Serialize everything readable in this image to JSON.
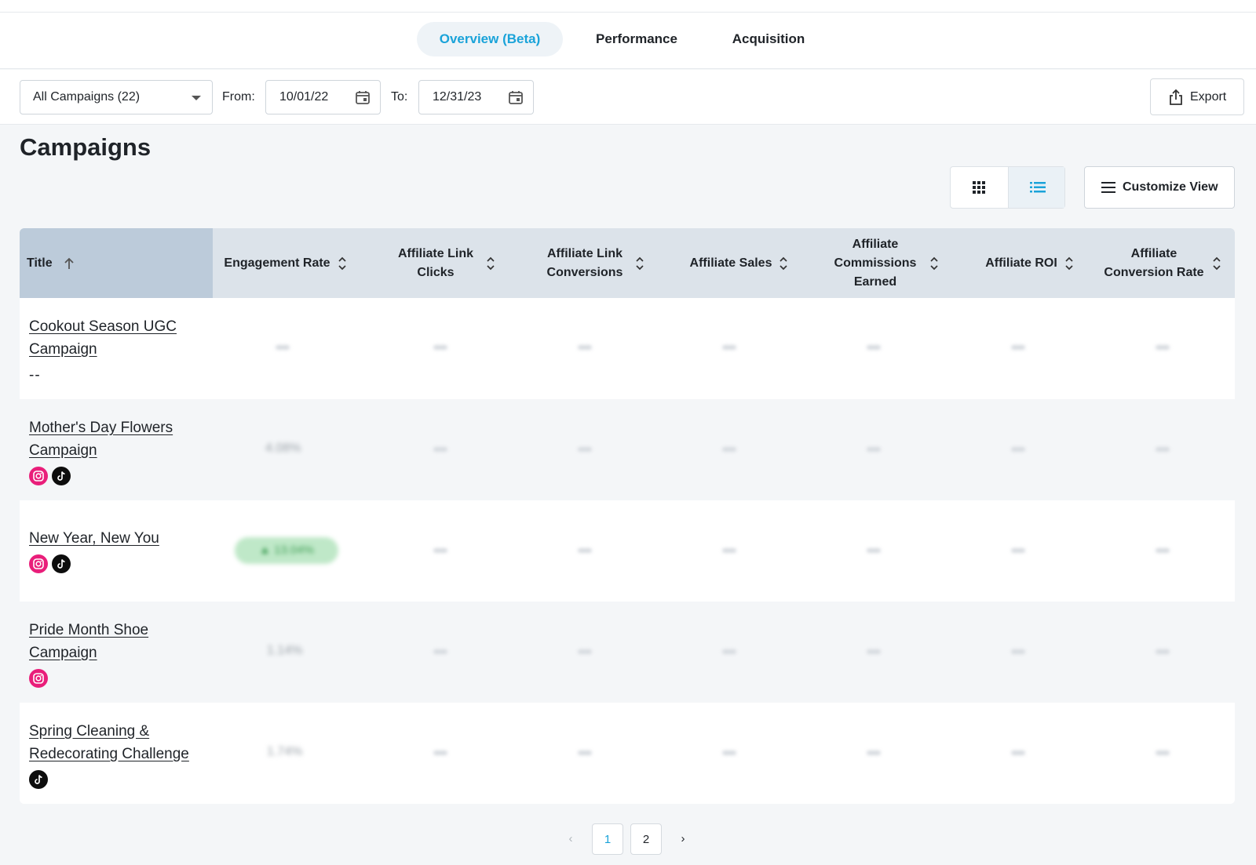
{
  "tabs": [
    {
      "label": "Overview (Beta)",
      "active": true
    },
    {
      "label": "Performance",
      "active": false
    },
    {
      "label": "Acquisition",
      "active": false
    }
  ],
  "filters": {
    "campaign_select": "All Campaigns (22)",
    "from_label": "From:",
    "from_value": "10/01/22",
    "to_label": "To:",
    "to_value": "12/31/23"
  },
  "export_label": "Export",
  "page_title": "Campaigns",
  "customize_label": "Customize View",
  "columns": [
    {
      "label": "Title"
    },
    {
      "label": "Engagement Rate"
    },
    {
      "label": "Affiliate Link Clicks"
    },
    {
      "label": "Affiliate Link Conversions"
    },
    {
      "label": "Affiliate Sales"
    },
    {
      "label": "Affiliate Commissions Earned"
    },
    {
      "label": "Affiliate ROI"
    },
    {
      "label": "Affiliate Conversion Rate"
    }
  ],
  "rows": [
    {
      "title": "Cookout Season UGC Campaign",
      "platforms_text": "--",
      "platforms": [],
      "engagement": "—"
    },
    {
      "title": "Mother's Day Flowers Campaign",
      "platforms": [
        "instagram",
        "tiktok"
      ],
      "engagement": "4.08%"
    },
    {
      "title": "New Year, New You",
      "platforms": [
        "instagram",
        "tiktok"
      ],
      "engagement": "13.04%"
    },
    {
      "title": "Pride Month Shoe Campaign",
      "platforms": [
        "instagram"
      ],
      "engagement": "1.14%"
    },
    {
      "title": "Spring Cleaning & Redecorating Challenge",
      "platforms": [
        "tiktok"
      ],
      "engagement": "1.74%"
    }
  ],
  "pagination": {
    "prev": "‹",
    "pages": [
      "1",
      "2"
    ],
    "current": "1",
    "next": "›"
  },
  "colors": {
    "accent": "#1aa3d9",
    "instagram": "#e91e7a",
    "tiktok": "#0d0d0d",
    "positive": "#3a9b50"
  }
}
